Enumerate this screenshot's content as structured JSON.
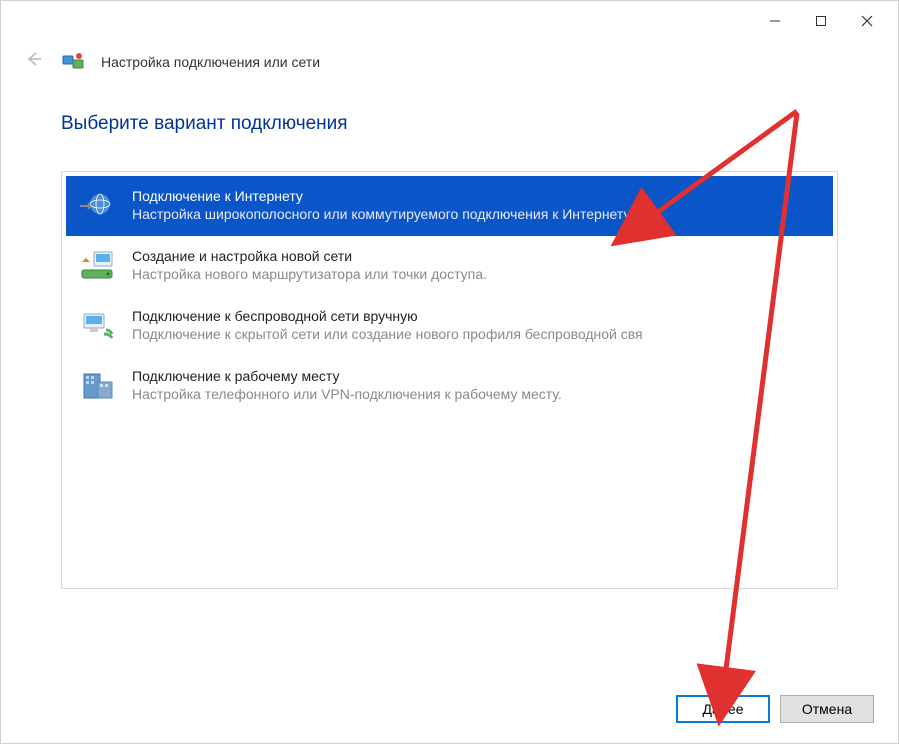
{
  "window": {
    "title": "Настройка подключения или сети"
  },
  "main": {
    "heading": "Выберите вариант подключения"
  },
  "options": [
    {
      "title": "Подключение к Интернету",
      "desc": "Настройка широкополосного или коммутируемого подключения к Интернету.",
      "icon": "globe",
      "selected": true
    },
    {
      "title": "Создание и настройка новой сети",
      "desc": "Настройка нового маршрутизатора или точки доступа.",
      "icon": "router",
      "selected": false
    },
    {
      "title": "Подключение к беспроводной сети вручную",
      "desc": "Подключение к скрытой сети или создание нового профиля беспроводной свя",
      "icon": "wireless",
      "selected": false
    },
    {
      "title": "Подключение к рабочему месту",
      "desc": "Настройка телефонного или VPN-подключения к рабочему месту.",
      "icon": "workplace",
      "selected": false
    }
  ],
  "footer": {
    "next_label": "Далее",
    "cancel_label": "Отмена"
  }
}
